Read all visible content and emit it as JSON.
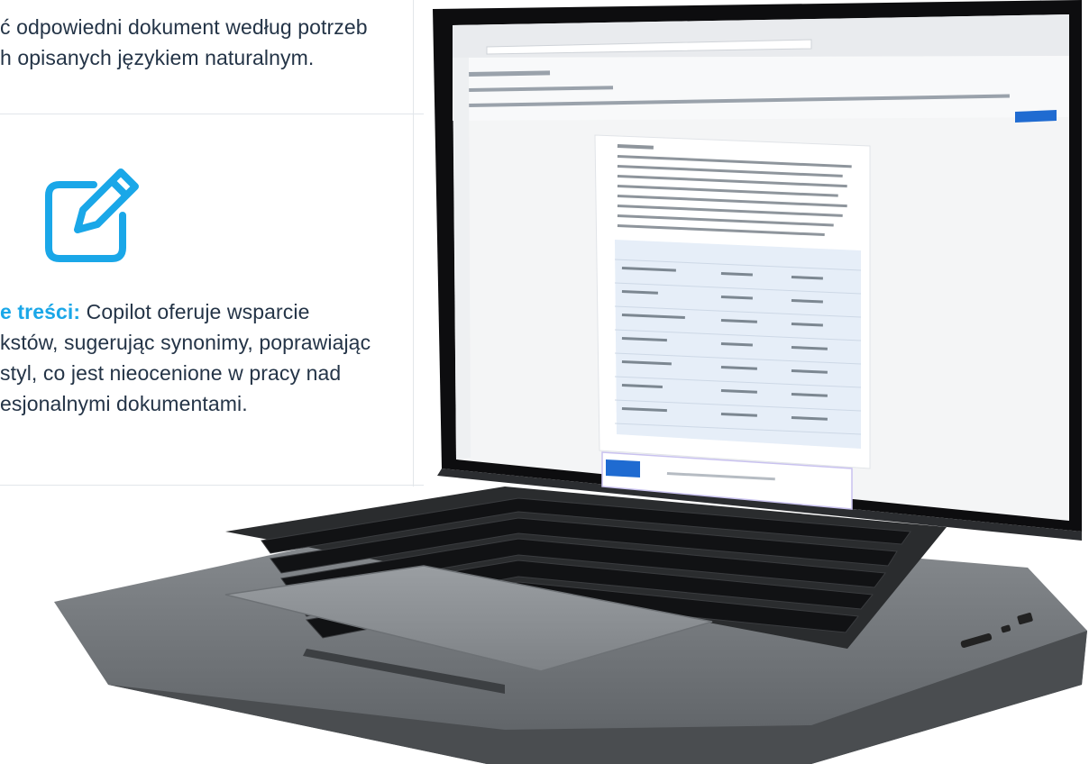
{
  "text": {
    "line1": "ć odpowiedni dokument według potrzeb",
    "line2": "h opisanych językiem naturalnym.",
    "feature_label": "e treści:",
    "feature_rest": " Copilot oferuje wsparcie",
    "line4": "kstów, sugerując synonimy, poprawiając",
    "line5": "styl, co jest nieocenione w pracy nad",
    "line6": "esjonalnymi dokumentami."
  },
  "icons": {
    "feature_icon": "edit-icon"
  },
  "colors": {
    "accent": "#1aa7e8",
    "body_text": "#243447",
    "laptop_body": "#6f7377",
    "bezel": "#0d0d0f",
    "word_blue": "#1f6bd1"
  }
}
